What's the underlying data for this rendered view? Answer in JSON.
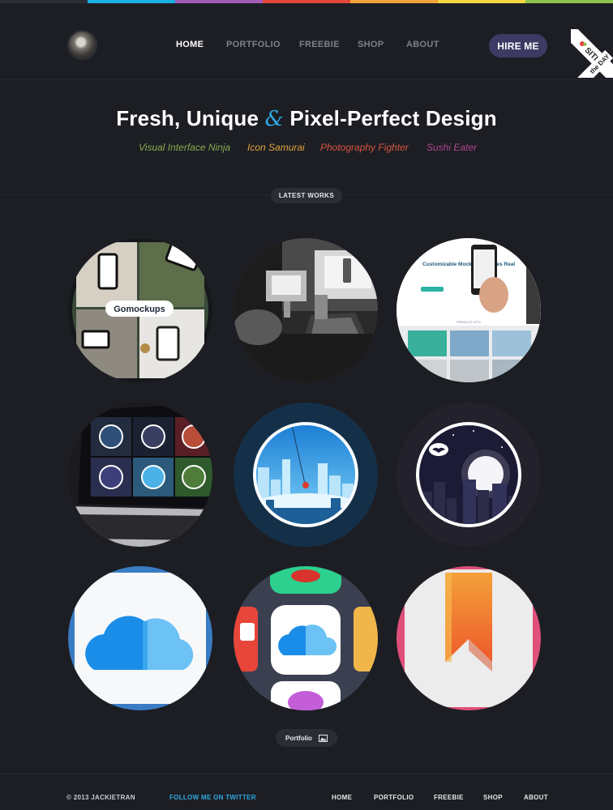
{
  "top_bar_colors": [
    "#2b2e35",
    "#1ab0e3",
    "#a35bb8",
    "#e2463a",
    "#f2a33a",
    "#f6d640",
    "#8bc34a"
  ],
  "header": {
    "avatar": "avatar-photo",
    "nav": [
      {
        "label": "HOME",
        "active": true
      },
      {
        "label": "PORTFOLIO",
        "active": false
      },
      {
        "label": "FREEBIE",
        "active": false
      },
      {
        "label": "SHOP",
        "active": false
      },
      {
        "label": "ABOUT",
        "active": false
      }
    ],
    "hire_label": "HIRE ME",
    "badge": {
      "site": "SITE",
      "of": "of",
      "the_day": "the DAY"
    }
  },
  "hero": {
    "title_part1": "Fresh, Unique",
    "title_amp": "&",
    "title_part2": "Pixel-Perfect Design",
    "taglines": [
      {
        "text": "Visual Interface Ninja",
        "color": "#8cab4e"
      },
      {
        "text": "Icon Samurai",
        "color": "#e0a33c"
      },
      {
        "text": "Photography Fighter",
        "color": "#d9553f"
      },
      {
        "text": "Sushi Eater",
        "color": "#b2458f"
      }
    ]
  },
  "works": {
    "section_label": "LATEST WORKS",
    "items": [
      {
        "name": "gomockups-work",
        "logo_text": "Gomockups"
      },
      {
        "name": "workspace-photo-work"
      },
      {
        "name": "mockup-devices-work",
        "heading": "Customizable Mockups Devices Real",
        "sub": "PRODUCT KITS"
      },
      {
        "name": "laptop-icons-work"
      },
      {
        "name": "city-hero-illustration-work"
      },
      {
        "name": "batman-night-illustration-work"
      },
      {
        "name": "cloud-icon-work"
      },
      {
        "name": "app-icons-work"
      },
      {
        "name": "bookmark-icon-work"
      }
    ],
    "portfolio_label": "Portfolio"
  },
  "footer": {
    "copyright": "© 2013 JACKIETRAN",
    "follow": "FOLLOW ME ON TWITTER",
    "nav": [
      "HOME",
      "PORTFOLIO",
      "FREEBIE",
      "SHOP",
      "ABOUT"
    ]
  }
}
